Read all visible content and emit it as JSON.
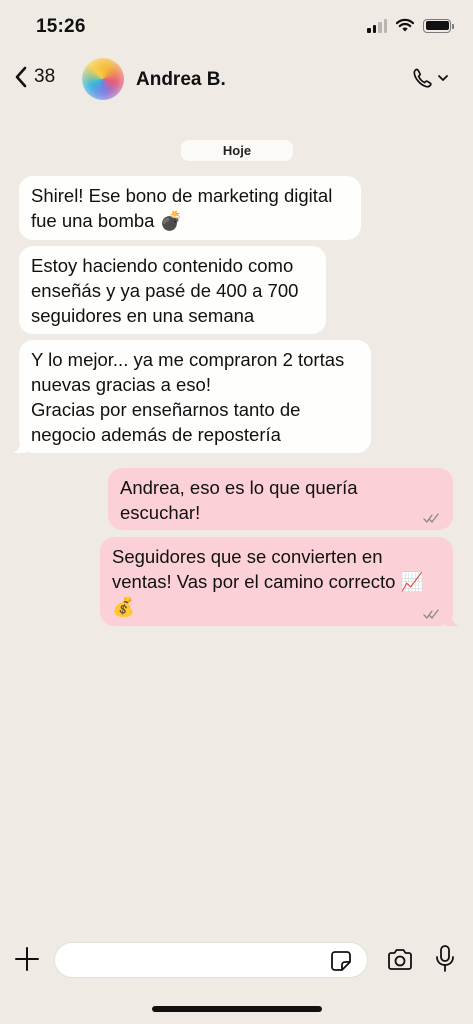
{
  "status_bar": {
    "time": "15:26"
  },
  "header": {
    "back_count": "38",
    "contact_name": "Andrea B."
  },
  "date_label": "Hoje",
  "messages": [
    {
      "direction": "in",
      "text": "Shirel! Ese bono de marketing digital\nfue una bomba 💣"
    },
    {
      "direction": "in",
      "text": "Estoy haciendo contenido como\nenseñás y ya pasé de 400 a 700\nseguidores en una semana"
    },
    {
      "direction": "in",
      "text": "Y lo mejor... ya me compraron 2 tortas\nnuevas gracias a eso!\nGracias por enseñarnos tanto de\nnegocio además de repostería"
    },
    {
      "direction": "out",
      "text": "Andrea, eso es lo que quería\nescuchar!"
    },
    {
      "direction": "out",
      "text": "Seguidores que se convierten en\nventas! Vas por el camino correcto 📈\n💰"
    }
  ],
  "composer": {
    "placeholder": ""
  },
  "icons": [
    "back-chevron-icon",
    "phone-icon",
    "chevron-down-icon",
    "plus-icon",
    "sticker-icon",
    "camera-icon",
    "microphone-icon",
    "double-check-icon",
    "wifi-icon",
    "battery-icon",
    "signal-icon"
  ],
  "colors": {
    "background": "#efebe4",
    "incoming": "#fefefd",
    "outgoing": "#fbd0d6"
  }
}
